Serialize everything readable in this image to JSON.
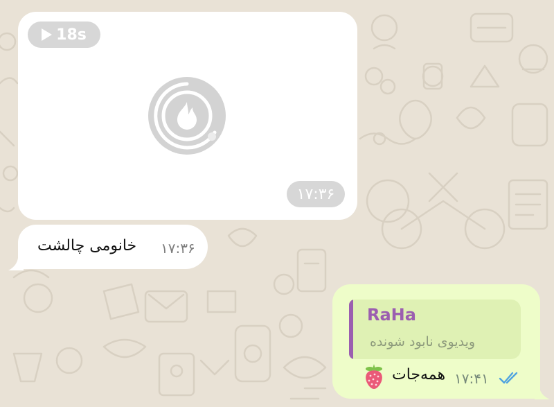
{
  "colors": {
    "wallpaper": "#e9e2d6",
    "incoming_bubble": "#ffffff",
    "outgoing_bubble": "#eefdc9",
    "reply_accent": "#9b5eb0",
    "read_checks": "#4fa3e0"
  },
  "video_message": {
    "duration": "18s",
    "time": "۱۷:۳۶",
    "icons": [
      "play-icon",
      "fire-loading-icon"
    ]
  },
  "text_message": {
    "text": "خانومی چالشت",
    "time": "۱۷:۳۶"
  },
  "reply_message": {
    "quoted_author": "RaHa",
    "quoted_text": "ویدیوی نابود شونده",
    "text": "همه‌جات",
    "time": "۱۷:۴۱",
    "status_icon": "double-check-icon",
    "emoji_icon": "strawberry-icon"
  }
}
